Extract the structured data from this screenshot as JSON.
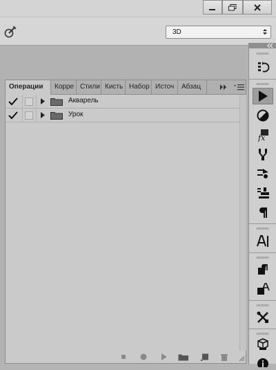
{
  "window": {
    "controls": [
      "minimize-icon",
      "restore-icon",
      "close-icon"
    ]
  },
  "options_bar": {
    "tool_icon": "brush-tool-icon",
    "preset_select_value": "3D"
  },
  "panel": {
    "tabs": [
      {
        "label": "Операции",
        "active": true
      },
      {
        "label": "Корре",
        "active": false
      },
      {
        "label": "Стили",
        "active": false
      },
      {
        "label": "Кисть",
        "active": false
      },
      {
        "label": "Набор",
        "active": false
      },
      {
        "label": "Источ",
        "active": false
      },
      {
        "label": "Абзац",
        "active": false
      }
    ],
    "overflow_icon": "double-chevron-right-icon",
    "menu_icon": "panel-menu-icon",
    "actions": [
      {
        "label": "Акварель",
        "checked": true
      },
      {
        "label": "Урок",
        "checked": true
      }
    ],
    "footer_icons": [
      "stop-icon",
      "record-icon",
      "play-icon",
      "folder-icon",
      "new-action-icon",
      "trash-icon"
    ]
  },
  "dock": {
    "collapse_icon": "double-chevron-left-icon",
    "buttons": [
      "history-icon",
      "actions-play-icon",
      "adjustments-icon",
      "styles-fx-icon",
      "brush-presets-icon",
      "brush-icon",
      "clone-source-icon",
      "paragraph-icon",
      "character-icon",
      "paragraph-styles-icon",
      "character-styles-icon",
      "tools-icon",
      "3d-icon",
      "info-icon"
    ]
  }
}
